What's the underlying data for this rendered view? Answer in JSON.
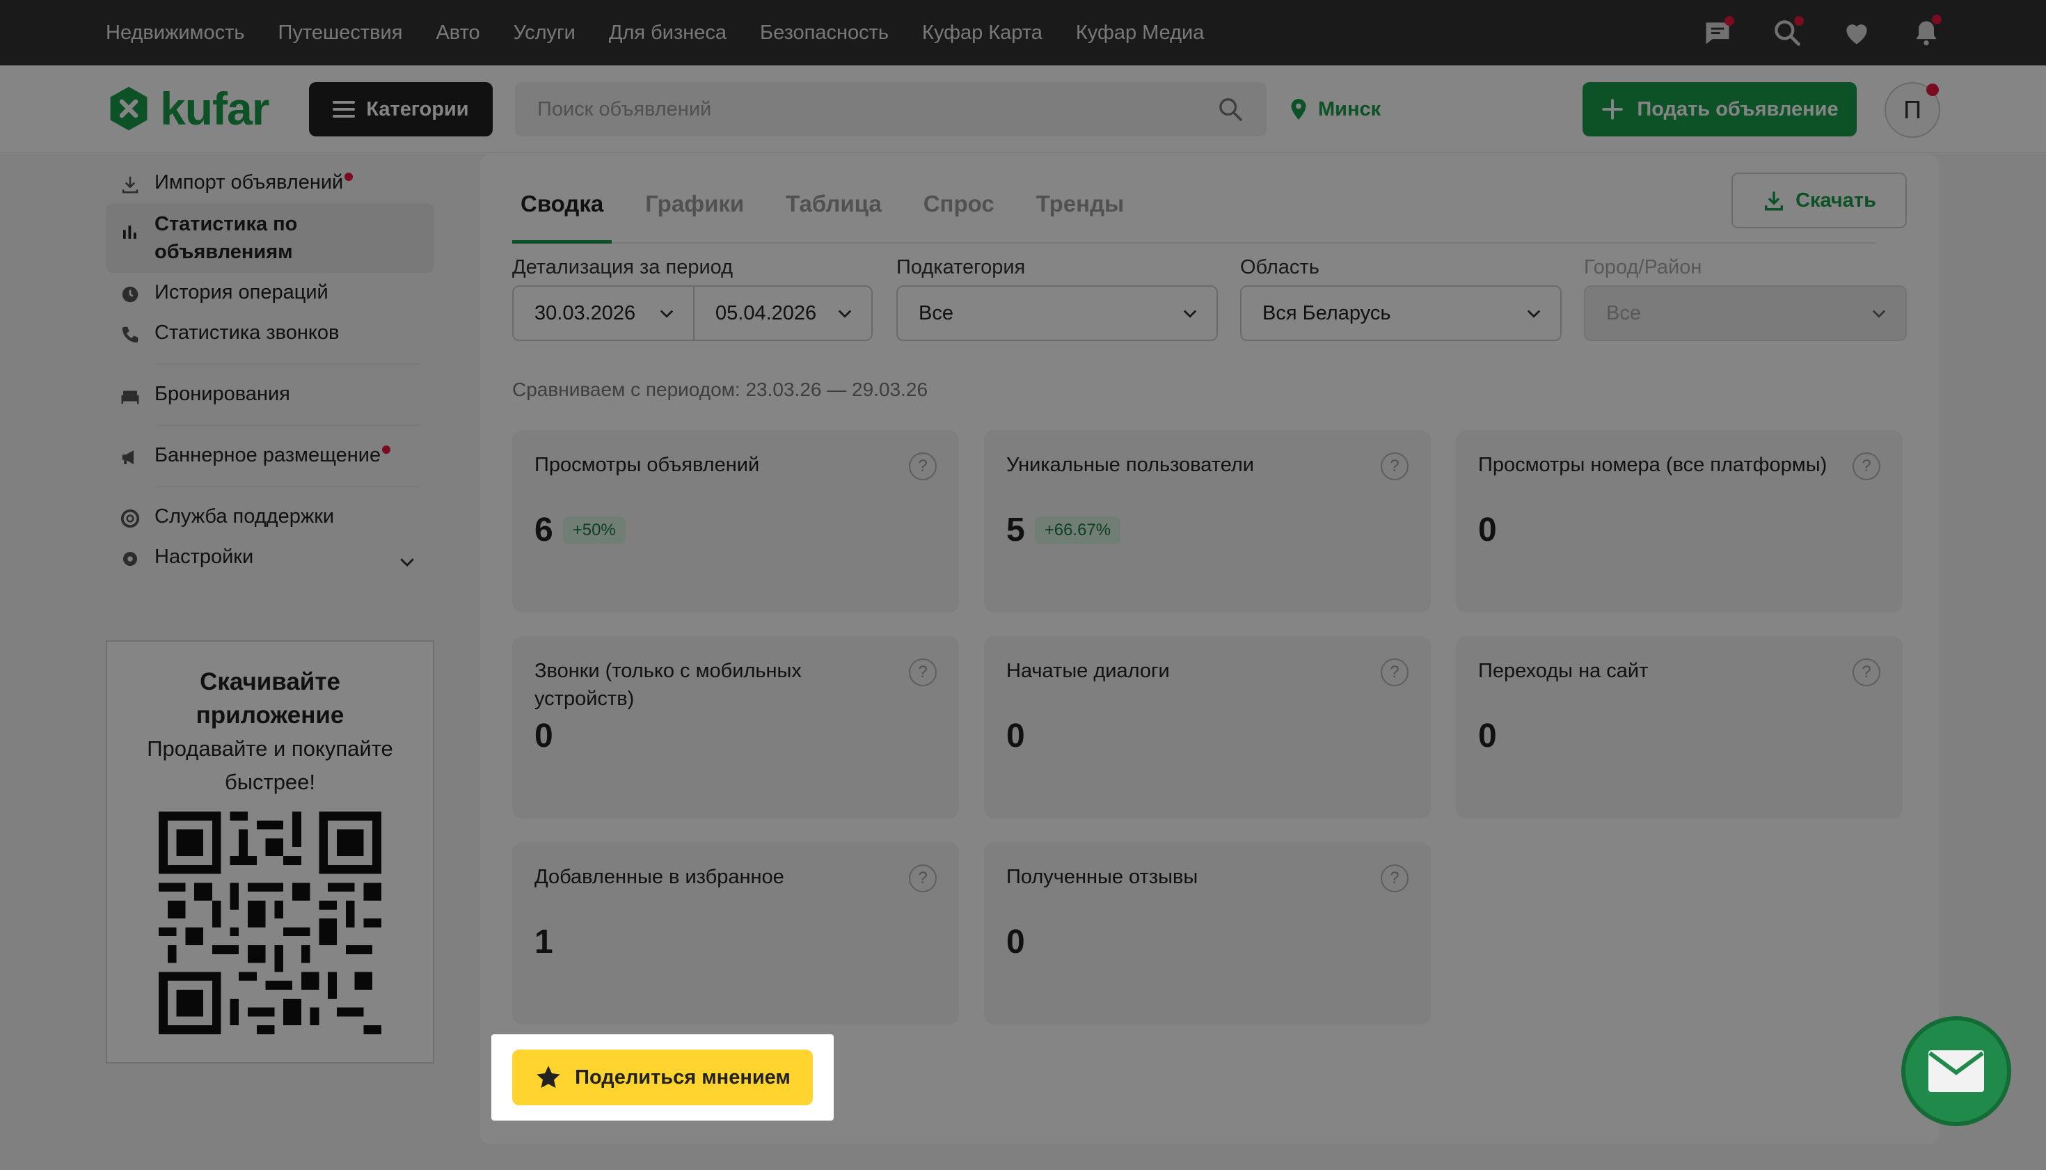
{
  "topnav": [
    "Недвижимость",
    "Путешествия",
    "Авто",
    "Услуги",
    "Для бизнеса",
    "Безопасность",
    "Куфар Карта",
    "Куфар Медиа"
  ],
  "header": {
    "logo_text": "kufar",
    "categories_label": "Категории",
    "search_placeholder": "Поиск объявлений",
    "location": "Минск",
    "post_label": "Подать объявление",
    "avatar_letter": "П"
  },
  "sidebar": {
    "items": [
      {
        "label": "Импорт объявлений",
        "icon": "download-icon"
      },
      {
        "label": "Статистика по объявлениям",
        "icon": "bar-chart-icon"
      },
      {
        "label": "История операций",
        "icon": "clock-icon"
      },
      {
        "label": "Статистика звонков",
        "icon": "phone-icon"
      },
      {
        "label": "Бронирования",
        "icon": "bed-icon"
      },
      {
        "label": "Баннерное размещение",
        "icon": "megaphone-icon"
      },
      {
        "label": "Служба поддержки",
        "icon": "lifebuoy-icon"
      },
      {
        "label": "Настройки",
        "icon": "gear-icon"
      }
    ]
  },
  "app_promo": {
    "title": "Скачивайте приложение",
    "subtitle": "Продавайте и покупайте быстрее!"
  },
  "tabs": [
    "Сводка",
    "Графики",
    "Таблица",
    "Спрос",
    "Тренды"
  ],
  "download_label": "Скачать",
  "filters": {
    "period_label": "Детализация за период",
    "date_from": "30.03.2026",
    "date_to": "05.04.2026",
    "subcategory_label": "Подкатегория",
    "subcategory_value": "Все",
    "region_label": "Область",
    "region_value": "Вся Беларусь",
    "city_label": "Город/Район",
    "city_value": "Все"
  },
  "compare_text": "Сравниваем с периодом: 23.03.26 — 29.03.26",
  "cards": [
    {
      "title": "Просмотры объявлений",
      "value": "6",
      "delta": "+50%"
    },
    {
      "title": "Уникальные пользователи",
      "value": "5",
      "delta": "+66.67%"
    },
    {
      "title": "Просмотры номера (все платформы)",
      "value": "0"
    },
    {
      "title": "Звонки (только с мобильных устройств)",
      "value": "0"
    },
    {
      "title": "Начатые диалоги",
      "value": "0"
    },
    {
      "title": "Переходы на сайт",
      "value": "0"
    },
    {
      "title": "Добавленные в избранное",
      "value": "1"
    },
    {
      "title": "Полученные отзывы",
      "value": "0"
    }
  ],
  "help_glyph": "?",
  "share_label": "Поделиться мнением",
  "colors": {
    "brand": "#1a9e4b",
    "accent_yellow": "#ffd42e",
    "topbar": "#333333",
    "notify": "#e8173d"
  }
}
